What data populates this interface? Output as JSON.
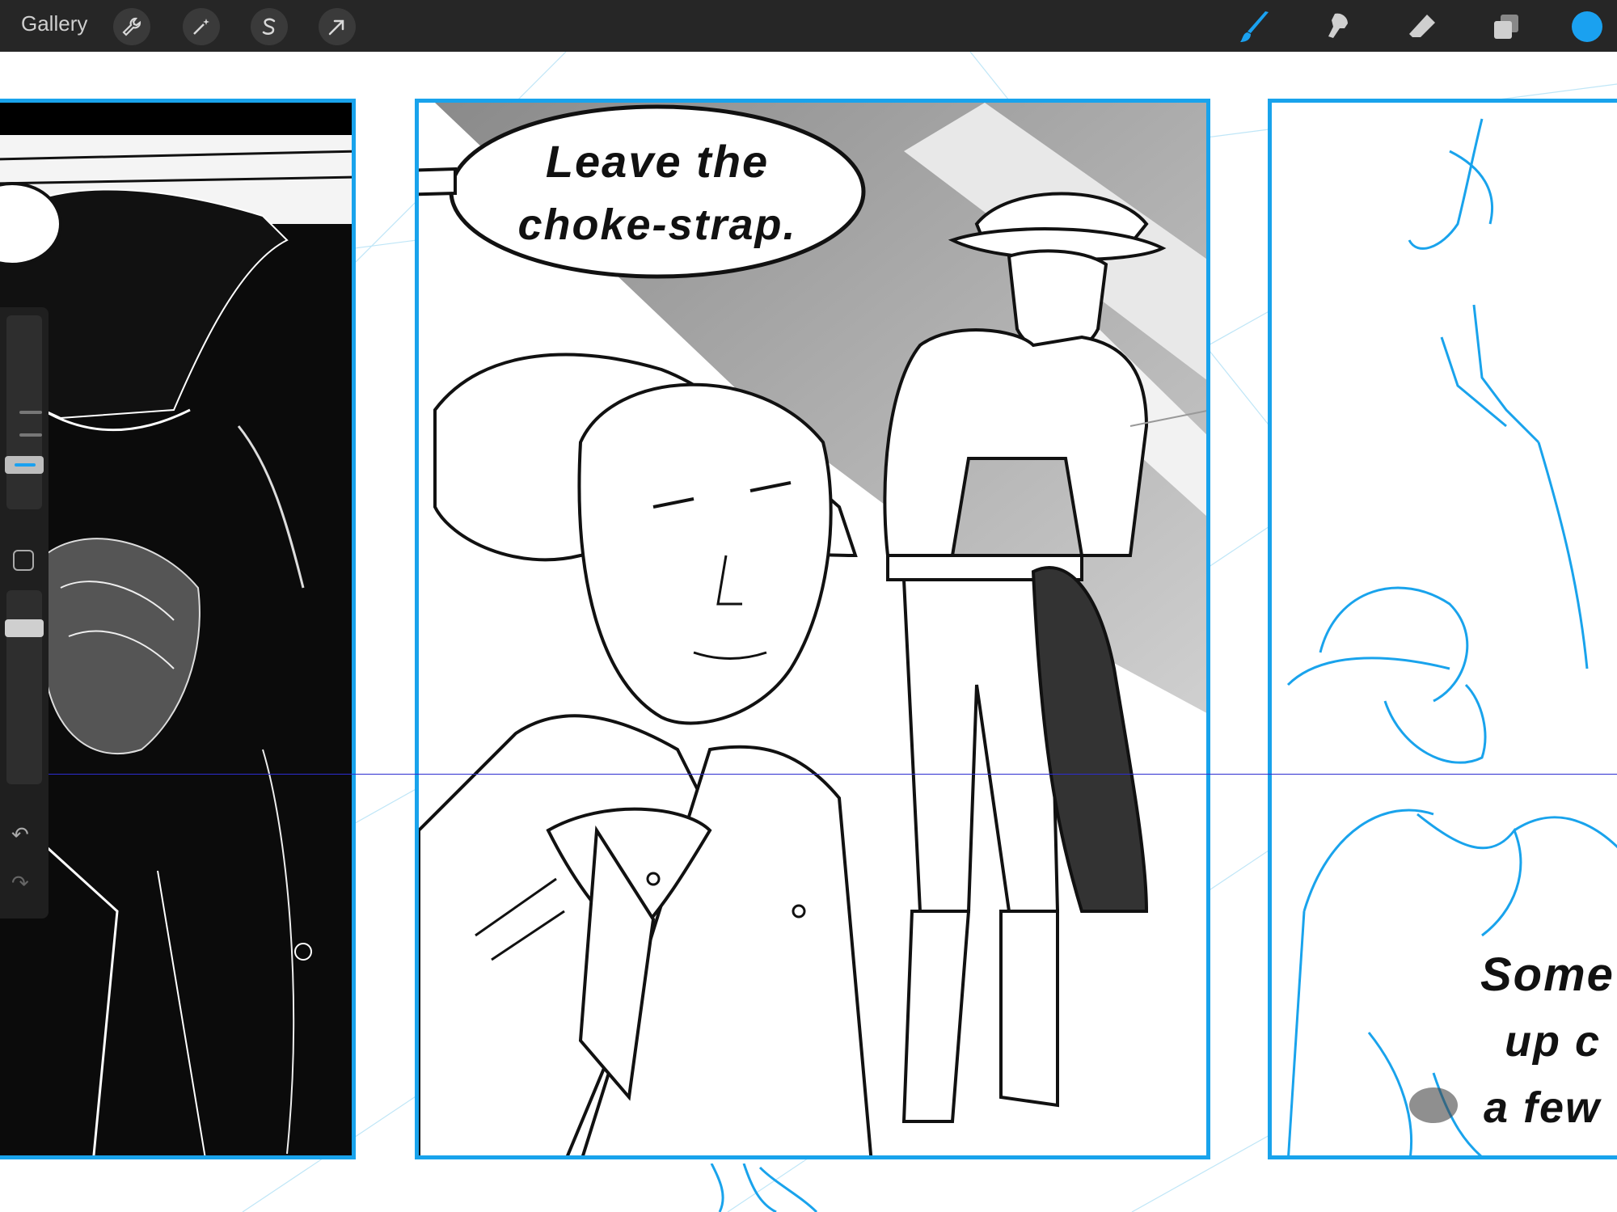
{
  "toolbar": {
    "gallery_label": "Gallery",
    "left_tools": [
      "actions-wrench-icon",
      "adjustments-magic-wand-icon",
      "selection-s-icon",
      "transform-arrow-icon"
    ],
    "right_tools": [
      "brush-icon",
      "smudge-icon",
      "eraser-icon",
      "layers-icon"
    ],
    "active_tool": "brush-icon",
    "current_color": "#1aa1f0"
  },
  "panels": {
    "middle": {
      "speech_line1": "Leave the",
      "speech_line2": "choke-strap."
    },
    "right": {
      "caption_line1": "Some",
      "caption_line2": "up c",
      "caption_line3": "a few"
    }
  },
  "sidebar": {
    "brush_size_label": "brush-size-slider",
    "opacity_label": "opacity-slider",
    "undo_symbol": "↶",
    "redo_symbol": "↷"
  },
  "colors": {
    "panel_border": "#19a3ec",
    "toolbar_bg": "#262626",
    "accent": "#1aa1f0"
  }
}
